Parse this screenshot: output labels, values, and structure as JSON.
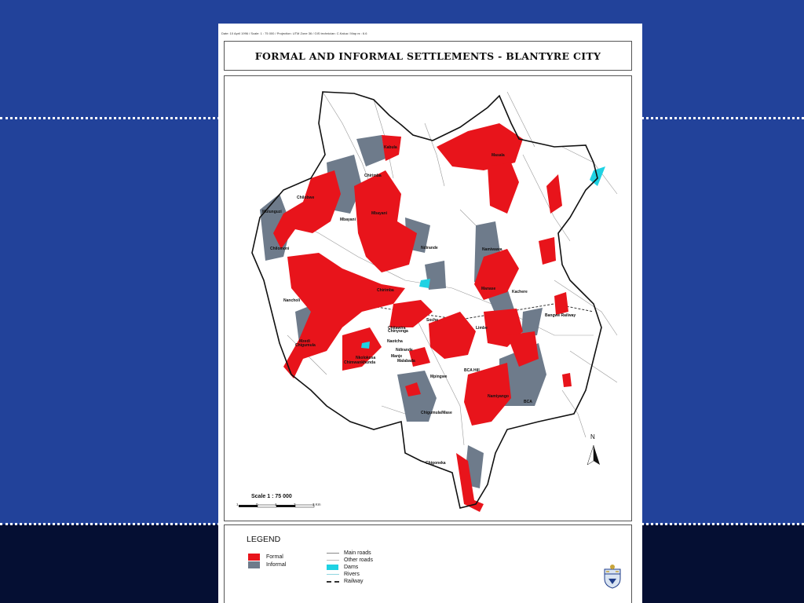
{
  "slide": {
    "background": "#22429a",
    "band_color": "#050f33",
    "dotted_line_color": "#ffffff"
  },
  "map_sheet": {
    "meta_line": "Date: 10 April 1996  /  Scale: 1 : 75 000  /  Projection: UTM Zone 36  /  GIS technician: C.Kalua  /  Map nr.: 6.6",
    "title": "FORMAL AND INFORMAL SETTLEMENTS - BLANTYRE CITY",
    "colors": {
      "formal": "#e8141b",
      "informal": "#6e7b8b",
      "dams": "#1fd2e3",
      "boundary": "#111111",
      "roads": "#999999"
    },
    "place_labels": [
      {
        "id": "kabula",
        "text": "Kabula"
      },
      {
        "id": "chilomoni",
        "text": "Chilomoni"
      },
      {
        "id": "chilobwe",
        "text": "Chilobwe"
      },
      {
        "id": "malabada",
        "text": "Malabada"
      },
      {
        "id": "mbayani",
        "text": "Mbayani"
      },
      {
        "id": "mulunguzi",
        "text": "Mulunguzi"
      },
      {
        "id": "chirimba",
        "text": "Chirimba"
      },
      {
        "id": "bangwe-railway",
        "text": "Bangwe Railway"
      },
      {
        "id": "ndirande",
        "text": "Ndirande"
      },
      {
        "id": "mbayani-2",
        "text": "Mbayani"
      },
      {
        "id": "namiwawa",
        "text": "Namiwawa"
      },
      {
        "id": "chinyonga",
        "text": "Chinyonga"
      },
      {
        "id": "chirimba-2",
        "text": "Chirimba"
      },
      {
        "id": "manase",
        "text": "Manase"
      },
      {
        "id": "masala",
        "text": "Masala"
      },
      {
        "id": "kachere",
        "text": "Kachere"
      },
      {
        "id": "soche",
        "text": "Soche"
      },
      {
        "id": "limbe",
        "text": "Limbe"
      },
      {
        "id": "bca-hill",
        "text": "BCA Hill"
      },
      {
        "id": "mpingwe",
        "text": "Mpingwe"
      },
      {
        "id": "nkolokosa",
        "text": "Nkolokosa"
      },
      {
        "id": "chitawira",
        "text": "Chitawira"
      },
      {
        "id": "naotcha",
        "text": "Naotcha"
      },
      {
        "id": "ndirande-2",
        "text": "Ndirande"
      },
      {
        "id": "manje",
        "text": "Manje"
      },
      {
        "id": "chigumula",
        "text": "Chigumula"
      },
      {
        "id": "chimwankhunda",
        "text": "Chimwankhunda"
      },
      {
        "id": "namiyango",
        "text": "Namiyango"
      },
      {
        "id": "nancholi",
        "text": "Nancholi"
      },
      {
        "id": "bca",
        "text": "BCA"
      },
      {
        "id": "chigumula-mase",
        "text": "Chigumula/Mase"
      },
      {
        "id": "chigoneka",
        "text": "Chigoneka"
      },
      {
        "id": "mzedi",
        "text": "Mzedi"
      }
    ],
    "north_label": "N",
    "scale_label": "Scale  1 : 75 000",
    "scale_ticks": [
      "1",
      "0",
      "1",
      "2",
      "3 Km"
    ]
  },
  "legend": {
    "title": "LEGEND",
    "formal": "Formal",
    "informal": "Informal",
    "main_roads": "Main roads",
    "other_roads": "Other roads",
    "dams": "Dams",
    "rivers": "Rivers",
    "railway": "Railway"
  }
}
